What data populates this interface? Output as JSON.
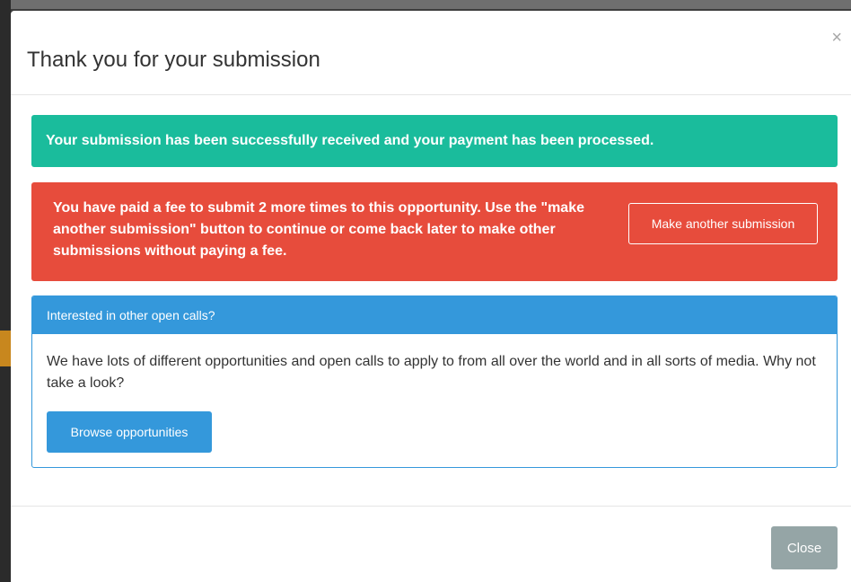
{
  "modal": {
    "title": "Thank you for your submission",
    "close_glyph": "×"
  },
  "alerts": {
    "success_text": "Your submission has been successfully received and your payment has been processed.",
    "danger_text": "You have paid a fee to submit 2 more times to this opportunity. Use the \"make another submission\" button to continue or come back later to make other submissions without paying a fee.",
    "make_another_label": "Make another submission"
  },
  "panel": {
    "heading": "Interested in other open calls?",
    "body": "We have lots of different opportunities and open calls to apply to from all over the world and in all sorts of media. Why not take a look?",
    "browse_label": "Browse opportunities"
  },
  "footer": {
    "close_label": "Close"
  },
  "colors": {
    "success": "#1abc9c",
    "danger": "#e74c3c",
    "info": "#3498db",
    "muted": "#95a5a6"
  },
  "icons": {
    "close": "close-icon"
  }
}
